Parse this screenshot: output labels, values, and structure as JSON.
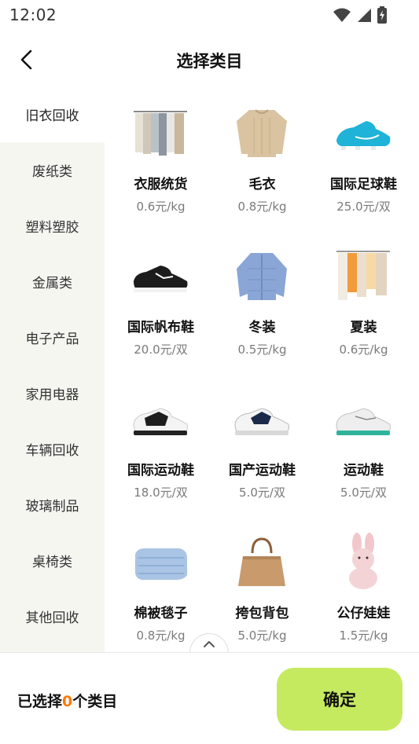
{
  "status": {
    "time": "12:02",
    "icons": [
      "wifi-icon",
      "signal-icon",
      "battery-charging-icon"
    ]
  },
  "header": {
    "title": "选择类目",
    "back_icon": "chevron-left-icon"
  },
  "sidebar": {
    "items": [
      {
        "label": "旧衣回收",
        "active": true
      },
      {
        "label": "废纸类"
      },
      {
        "label": "塑料塑胶"
      },
      {
        "label": "金属类"
      },
      {
        "label": "电子产品"
      },
      {
        "label": "家用电器"
      },
      {
        "label": "车辆回收"
      },
      {
        "label": "玻璃制品"
      },
      {
        "label": "桌椅类"
      },
      {
        "label": "其他回收"
      }
    ]
  },
  "products": [
    {
      "name": "衣服统货",
      "price": "0.6元/kg",
      "icon": "clothes-rack-icon"
    },
    {
      "name": "毛衣",
      "price": "0.8元/kg",
      "icon": "sweater-icon"
    },
    {
      "name": "国际足球鞋",
      "price": "25.0元/双",
      "icon": "football-boot-icon"
    },
    {
      "name": "国际帆布鞋",
      "price": "20.0元/双",
      "icon": "canvas-shoe-icon"
    },
    {
      "name": "冬装",
      "price": "0.5元/kg",
      "icon": "puffer-jacket-icon"
    },
    {
      "name": "夏装",
      "price": "0.6元/kg",
      "icon": "summer-clothes-icon"
    },
    {
      "name": "国际运动鞋",
      "price": "18.0元/双",
      "icon": "sneaker-icon"
    },
    {
      "name": "国产运动鞋",
      "price": "5.0元/双",
      "icon": "sneaker-icon"
    },
    {
      "name": "运动鞋",
      "price": "5.0元/双",
      "icon": "running-shoe-icon"
    },
    {
      "name": "棉被毯子",
      "price": "0.8元/kg",
      "icon": "blanket-icon"
    },
    {
      "name": "挎包背包",
      "price": "5.0元/kg",
      "icon": "handbag-icon"
    },
    {
      "name": "公仔娃娃",
      "price": "1.5元/kg",
      "icon": "plush-bunny-icon"
    }
  ],
  "footer": {
    "selected_prefix": "已选择",
    "selected_count": "0",
    "selected_suffix": "个类目",
    "confirm_label": "确定"
  },
  "colors": {
    "accent": "#c6ea5f",
    "count": "#ff7a00",
    "sidebar_bg": "#f6f6f1"
  }
}
